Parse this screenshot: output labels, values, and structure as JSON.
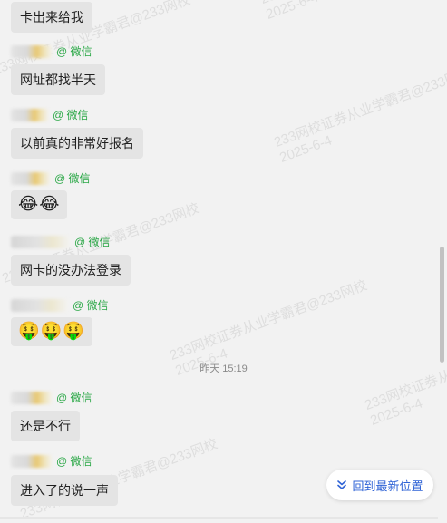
{
  "watermark": {
    "text": "233网校证券从业学霸君@233网校",
    "date": "2025-6-4"
  },
  "messages": [
    {
      "text": "卡出来给我"
    },
    {
      "source": "@ 微信",
      "text": "网址都找半天"
    },
    {
      "source": "@ 微信",
      "text": "以前真的非常好报名"
    },
    {
      "source": "@ 微信",
      "text": "😂😂"
    },
    {
      "source": "@ 微信",
      "text": "网卡的没办法登录"
    },
    {
      "source": "@ 微信",
      "text": "🤑🤑🤑"
    },
    {
      "source": "@ 微信",
      "text": "还是不行"
    },
    {
      "source": "@ 微信",
      "text": "进入了的说一声"
    }
  ],
  "timestamp": "昨天 15:19",
  "jump_button": {
    "label": "回到最新位置",
    "icon": "chevron-double-down-icon"
  },
  "colors": {
    "accent": "#2f63d6",
    "source_green": "#29a745",
    "bubble": "#e4e4e4",
    "background": "#f2f2f2"
  }
}
